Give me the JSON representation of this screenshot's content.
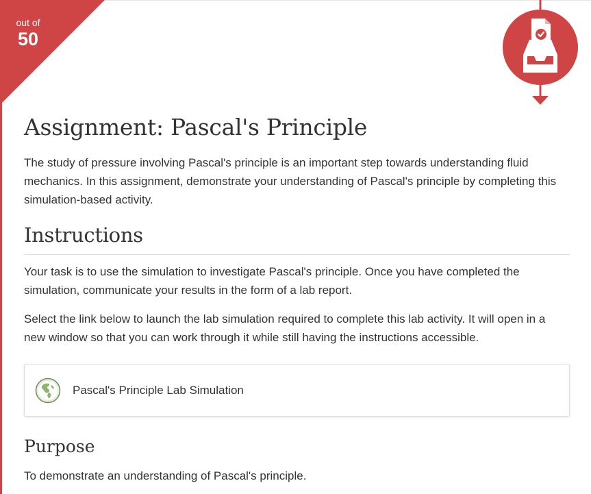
{
  "score": {
    "label": "out of",
    "value": "50"
  },
  "badge": {
    "icon": "assignment-tray-icon"
  },
  "assignment": {
    "title": "Assignment: Pascal's Principle",
    "intro": "The study of pressure involving Pascal's principle is an important step towards understanding fluid mechanics. In this assignment, demonstrate your understanding of Pascal's principle by completing this simulation-based activity."
  },
  "instructions": {
    "heading": "Instructions",
    "paragraphs": [
      "Your task is to use the simulation to investigate Pascal's principle. Once you have completed the simulation, communicate your results in the form of a lab report.",
      "Select the link below to launch the lab simulation required to complete this lab activity. It will open in a new window so that you can work through it while still having the instructions accessible."
    ]
  },
  "link": {
    "icon": "globe-icon",
    "label": "Pascal's Principle Lab Simulation"
  },
  "purpose": {
    "heading": "Purpose",
    "text": "To demonstrate an understanding of Pascal's principle."
  },
  "colors": {
    "accent": "#cf4444",
    "text": "#333333",
    "globe_green": "#9bbf7a"
  }
}
